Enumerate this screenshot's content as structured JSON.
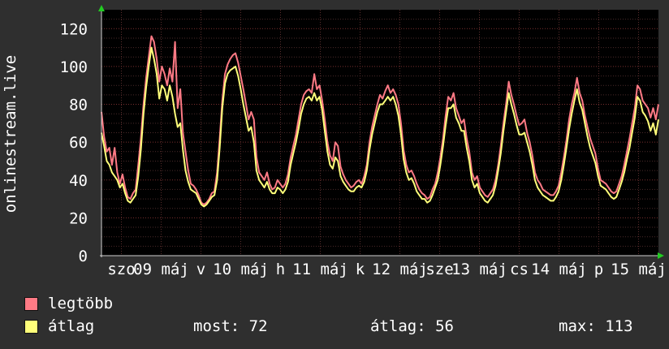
{
  "chart_data": {
    "type": "line",
    "ylabel": "onlinestream.live",
    "ylim": [
      0,
      130
    ],
    "y_ticks": [
      0,
      20,
      40,
      60,
      80,
      100,
      120
    ],
    "x_tick_labels": [
      "szo",
      "09 máj",
      "v",
      "10 máj",
      "h",
      "11 máj",
      "k",
      "12 máj",
      "sze",
      "13 máj",
      "cs",
      "14 máj",
      "p",
      "15 máj"
    ],
    "grid": true,
    "series": [
      {
        "name": "legtöbb",
        "color": "#ff7a85",
        "values": [
          76,
          63,
          55,
          57,
          48,
          57,
          44,
          38,
          43,
          36,
          31,
          30,
          33,
          35,
          48,
          62,
          80,
          94,
          105,
          116,
          113,
          104,
          92,
          100,
          96,
          90,
          99,
          92,
          113,
          78,
          88,
          65,
          55,
          45,
          38,
          37,
          35,
          32,
          28,
          27,
          28,
          30,
          33,
          34,
          44,
          62,
          82,
          96,
          101,
          104,
          106,
          107,
          102,
          95,
          88,
          80,
          72,
          76,
          72,
          52,
          44,
          42,
          40,
          44,
          38,
          35,
          36,
          40,
          38,
          36,
          38,
          43,
          52,
          58,
          64,
          72,
          80,
          85,
          87,
          88,
          86,
          96,
          88,
          90,
          82,
          72,
          60,
          53,
          50,
          60,
          58,
          47,
          43,
          40,
          38,
          36,
          37,
          39,
          40,
          38,
          42,
          48,
          60,
          68,
          74,
          80,
          85,
          83,
          87,
          90,
          86,
          88,
          85,
          80,
          70,
          56,
          48,
          44,
          45,
          42,
          38,
          35,
          33,
          32,
          30,
          31,
          35,
          38,
          44,
          52,
          62,
          74,
          84,
          82,
          86,
          78,
          74,
          70,
          72,
          62,
          55,
          44,
          40,
          42,
          36,
          34,
          32,
          31,
          33,
          35,
          40,
          48,
          58,
          70,
          80,
          92,
          85,
          80,
          74,
          69,
          70,
          72,
          65,
          60,
          53,
          44,
          40,
          38,
          35,
          34,
          33,
          32,
          32,
          34,
          37,
          44,
          52,
          61,
          72,
          80,
          86,
          94,
          86,
          82,
          74,
          68,
          62,
          58,
          54,
          46,
          40,
          39,
          38,
          36,
          34,
          33,
          34,
          38,
          42,
          48,
          55,
          62,
          70,
          78,
          90,
          88,
          82,
          80,
          78,
          73,
          78,
          72,
          80
        ]
      },
      {
        "name": "átlag",
        "color": "#ffff7a",
        "values": [
          65,
          58,
          50,
          48,
          44,
          42,
          40,
          36,
          38,
          33,
          29,
          28,
          30,
          32,
          42,
          56,
          75,
          89,
          100,
          110,
          104,
          96,
          83,
          90,
          88,
          82,
          90,
          84,
          75,
          68,
          70,
          56,
          45,
          39,
          35,
          34,
          33,
          30,
          27,
          26,
          27,
          29,
          31,
          32,
          40,
          57,
          78,
          91,
          96,
          98,
          99,
          100,
          95,
          88,
          80,
          73,
          66,
          68,
          60,
          45,
          40,
          38,
          36,
          39,
          35,
          33,
          33,
          36,
          35,
          33,
          35,
          39,
          48,
          54,
          60,
          67,
          75,
          80,
          83,
          84,
          82,
          86,
          82,
          84,
          77,
          66,
          55,
          48,
          46,
          52,
          50,
          42,
          39,
          37,
          35,
          34,
          34,
          36,
          37,
          36,
          39,
          45,
          56,
          64,
          70,
          76,
          80,
          80,
          82,
          84,
          82,
          84,
          80,
          74,
          64,
          51,
          44,
          40,
          41,
          38,
          34,
          32,
          30,
          30,
          28,
          29,
          32,
          36,
          40,
          48,
          58,
          69,
          78,
          78,
          80,
          73,
          70,
          66,
          66,
          57,
          50,
          40,
          36,
          38,
          33,
          31,
          29,
          28,
          30,
          32,
          37,
          45,
          54,
          66,
          76,
          86,
          80,
          75,
          69,
          64,
          64,
          65,
          60,
          55,
          48,
          40,
          36,
          34,
          32,
          31,
          30,
          29,
          29,
          31,
          34,
          40,
          48,
          57,
          67,
          75,
          82,
          88,
          81,
          77,
          70,
          63,
          57,
          53,
          49,
          42,
          37,
          36,
          35,
          33,
          31,
          30,
          31,
          35,
          39,
          44,
          51,
          57,
          65,
          73,
          84,
          82,
          76,
          74,
          71,
          66,
          70,
          64,
          72
        ]
      }
    ]
  },
  "legend": [
    {
      "label": "legtöbb",
      "color": "#ff7a85"
    },
    {
      "label": "átlag",
      "color": "#ffff7a"
    }
  ],
  "stats": {
    "most": "most: 72",
    "atlag": "átlag: 56",
    "max": "max: 113"
  }
}
